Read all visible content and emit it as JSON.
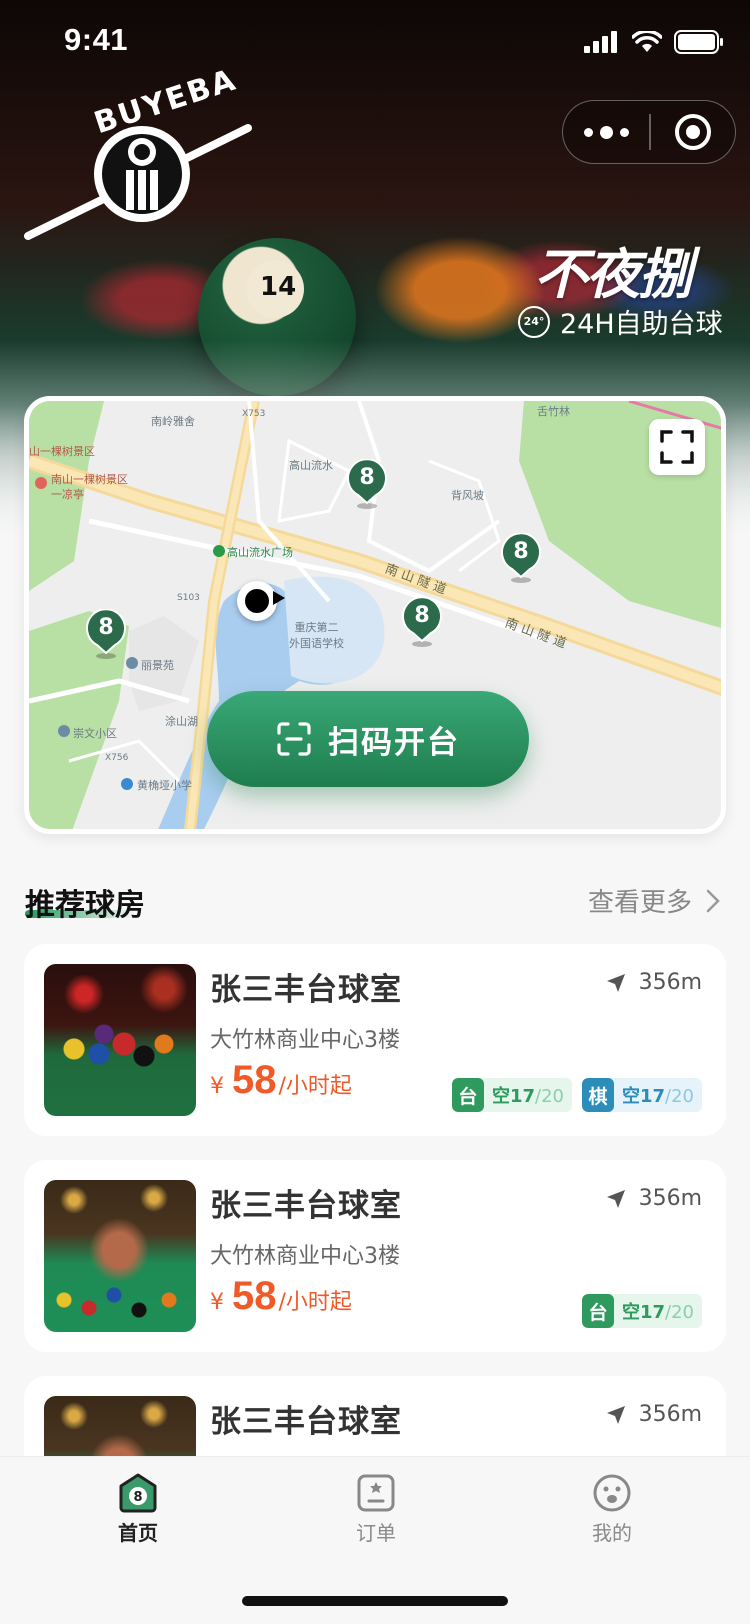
{
  "status_bar": {
    "time": "9:41"
  },
  "hero": {
    "logo_text": "BUYEBA",
    "ball_number": "14",
    "brand_title": "不夜捌",
    "badge": "24°",
    "subtitle": "24H自助台球"
  },
  "map": {
    "labels": {
      "nanling": "南岭雅舍",
      "x753": "X753",
      "shanyikeshu_top": "山一棵树景区",
      "nanshan_scenic": "南山一棵树景区",
      "liangting": "一凉亭",
      "gaoshan_liushui": "高山流水",
      "beifeng": "背风坡",
      "shezhulin": "舌竹林",
      "gaoshan_square": "高山流水广场",
      "s103": "S103",
      "nanshan_tunnel_1": "南山隧道",
      "nanshan_tunnel_2": "南山隧道",
      "school": "重庆第二\n外国语学校",
      "lijingyuan": "丽景苑",
      "chongwen": "崇文小区",
      "x756": "X756",
      "tushan_lake": "涂山湖",
      "huangjueya": "黄桷垭小学"
    },
    "pins": [
      "8",
      "8",
      "8",
      "8"
    ],
    "scan_button": "扫码开台"
  },
  "section": {
    "title": "推荐球房",
    "more": "查看更多"
  },
  "rooms": [
    {
      "name": "张三丰台球室",
      "distance": "356m",
      "address": "大竹林商业中心3楼",
      "price_yen": "¥",
      "price": "58",
      "price_unit": "/小时起",
      "tags": [
        {
          "key": "台",
          "label": "空",
          "free": "17",
          "total": "/20",
          "color": "green"
        },
        {
          "key": "棋",
          "label": "空",
          "free": "17",
          "total": "/20",
          "color": "blue"
        }
      ]
    },
    {
      "name": "张三丰台球室",
      "distance": "356m",
      "address": "大竹林商业中心3楼",
      "price_yen": "¥",
      "price": "58",
      "price_unit": "/小时起",
      "tags": [
        {
          "key": "台",
          "label": "空",
          "free": "17",
          "total": "/20",
          "color": "green"
        }
      ]
    },
    {
      "name": "张三丰台球室",
      "distance": "356m"
    }
  ],
  "tabbar": {
    "items": [
      {
        "label": "首页",
        "icon": "home-8ball-icon",
        "active": true,
        "icon_text": "8"
      },
      {
        "label": "订单",
        "icon": "order-icon",
        "active": false
      },
      {
        "label": "我的",
        "icon": "profile-face-icon",
        "active": false
      }
    ]
  },
  "colors": {
    "accent": "#1f7d4e",
    "price": "#f05a28",
    "tag_green": "#2e9a5e",
    "tag_blue": "#2b8db8"
  }
}
